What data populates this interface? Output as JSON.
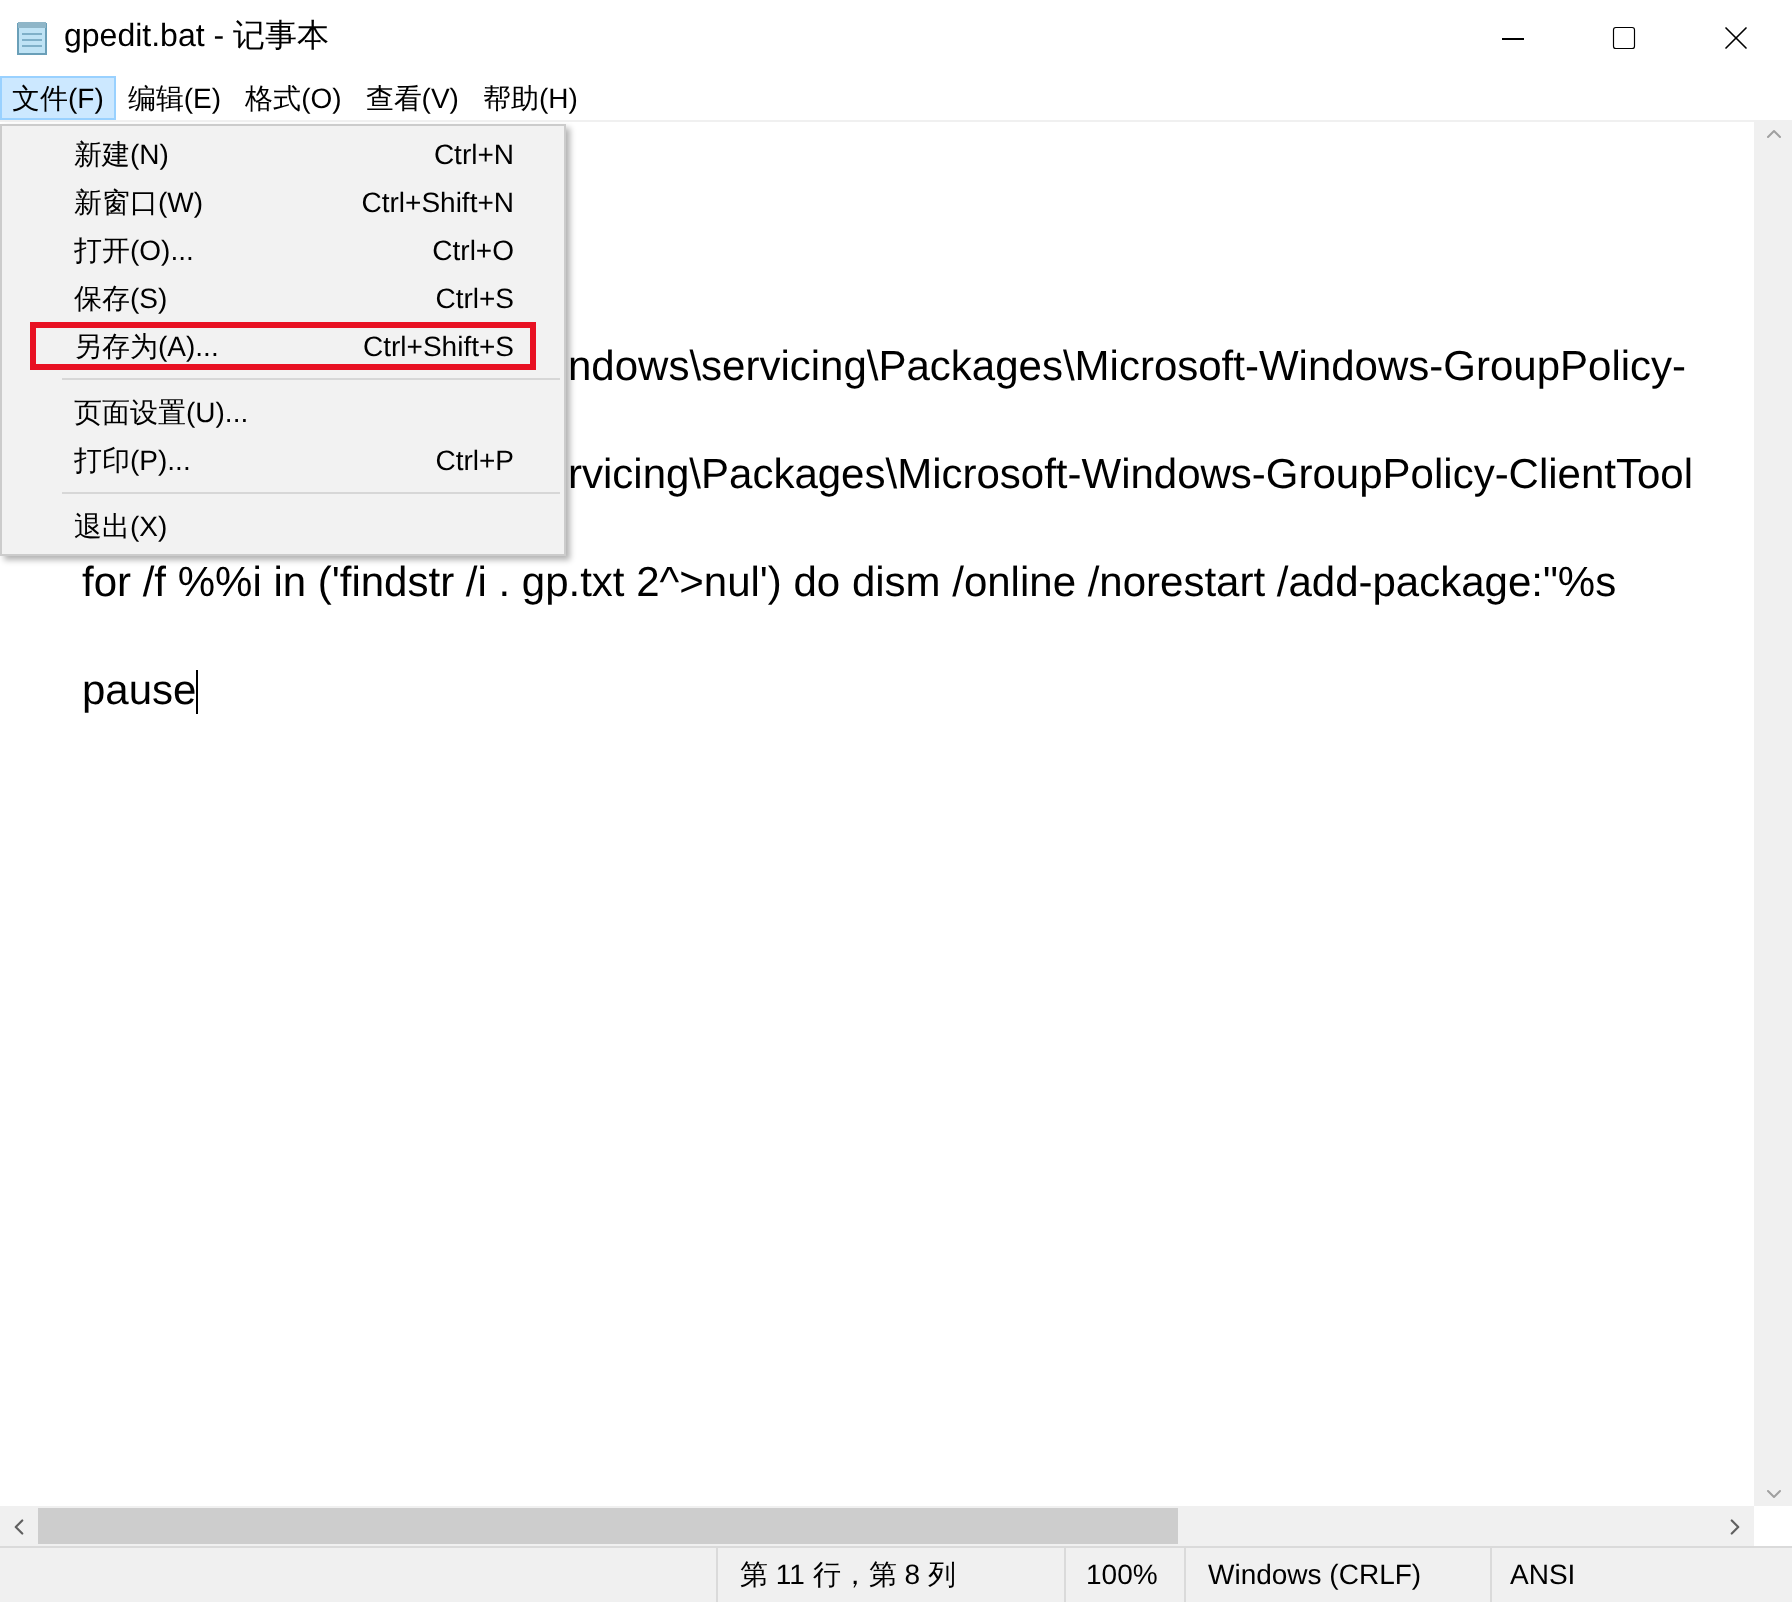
{
  "window": {
    "title": "gpedit.bat - 记事本"
  },
  "menu_bar": [
    {
      "label": "文件(F)",
      "selected": true
    },
    {
      "label": "编辑(E)",
      "selected": false
    },
    {
      "label": "格式(O)",
      "selected": false
    },
    {
      "label": "查看(V)",
      "selected": false
    },
    {
      "label": "帮助(H)",
      "selected": false
    }
  ],
  "file_menu": [
    {
      "kind": "item",
      "label": "新建(N)",
      "shortcut": "Ctrl+N",
      "highlighted": false
    },
    {
      "kind": "item",
      "label": "新窗口(W)",
      "shortcut": "Ctrl+Shift+N",
      "highlighted": false
    },
    {
      "kind": "item",
      "label": "打开(O)...",
      "shortcut": "Ctrl+O",
      "highlighted": false
    },
    {
      "kind": "item",
      "label": "保存(S)",
      "shortcut": "Ctrl+S",
      "highlighted": false
    },
    {
      "kind": "item",
      "label": "另存为(A)...",
      "shortcut": "Ctrl+Shift+S",
      "highlighted": true
    },
    {
      "kind": "separator"
    },
    {
      "kind": "item",
      "label": "页面设置(U)..."
    },
    {
      "kind": "item",
      "label": "打印(P)...",
      "shortcut": "Ctrl+P",
      "highlighted": false
    },
    {
      "kind": "separator"
    },
    {
      "kind": "item",
      "label": "退出(X)",
      "highlighted": false
    }
  ],
  "editor": {
    "lines": [
      {
        "kind": "covered",
        "text": "ndows\\servicing\\Packages\\Microsoft-Windows-GroupPolicy-",
        "caret": false
      },
      {
        "kind": "covered",
        "text": "rvicing\\Packages\\Microsoft-Windows-GroupPolicy-ClientTool",
        "caret": false
      },
      {
        "kind": "full",
        "text": "for /f %%i in ('findstr /i . gp.txt 2^>nul') do dism /online /norestart /add-package:\"%s",
        "caret": false
      },
      {
        "kind": "full",
        "text": "pause",
        "caret": true
      }
    ]
  },
  "status_bar": {
    "position": "第 11 行，第 8 列",
    "zoom": "100%",
    "line_ending": "Windows (CRLF)",
    "encoding": "ANSI"
  }
}
